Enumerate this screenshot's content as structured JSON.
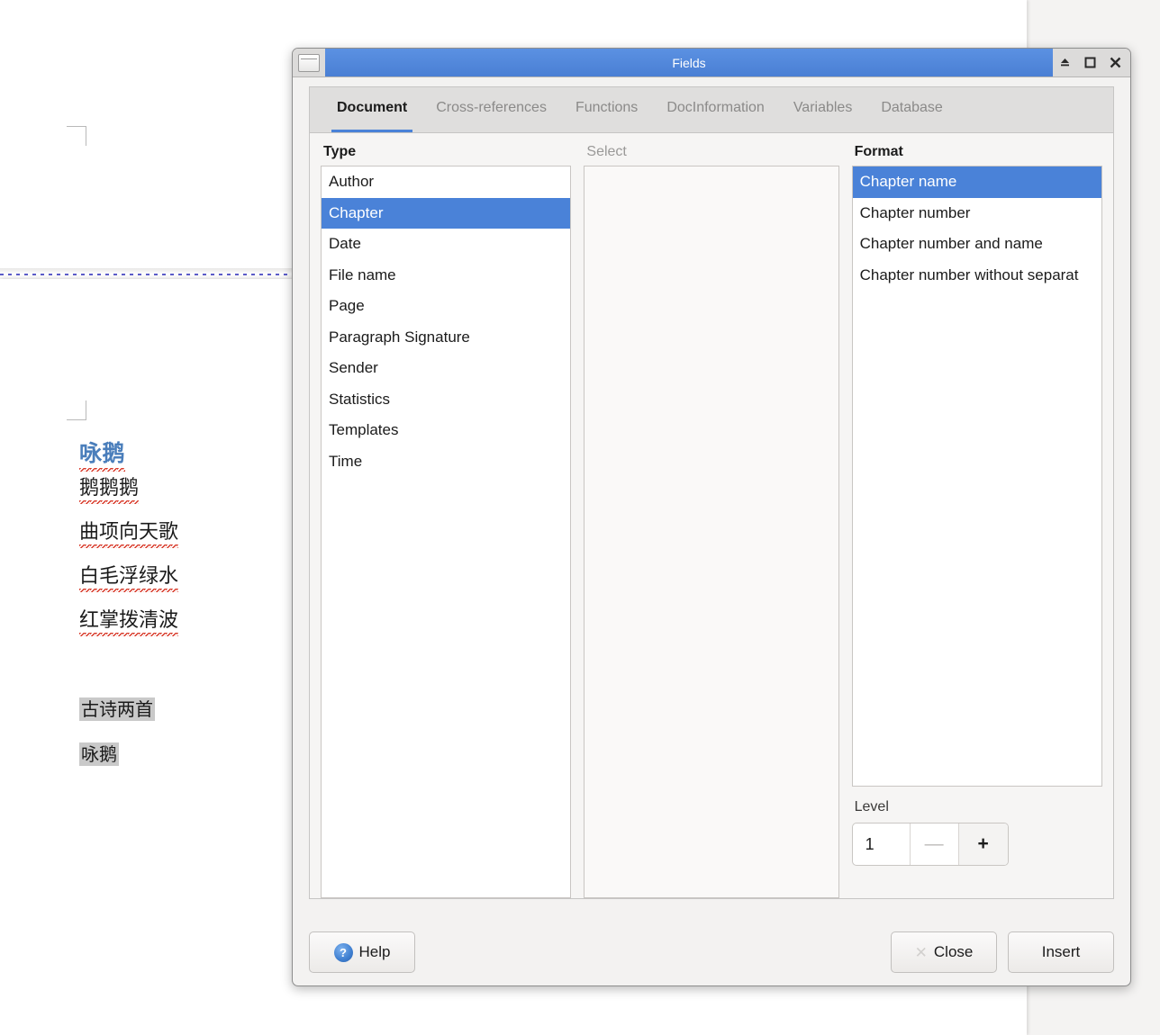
{
  "document": {
    "poem_title": "咏鹅",
    "poem_lines": [
      "鹅鹅鹅",
      "曲项向天歌",
      "白毛浮绿水",
      "红掌拨清波"
    ],
    "fields": [
      "古诗两首",
      "咏鹅"
    ],
    "heading_color": "#4a7ebb",
    "spellcheck_underline_color": "#d83a2a",
    "field_shading_color": "#c9c9c9",
    "page_break_line_color": "#5b5bc8"
  },
  "dialog": {
    "title": "Fields",
    "accent_color": "#4a82d8",
    "titlebar_color": "#4a7fd4",
    "window_buttons": [
      {
        "name": "minimize-icon",
        "glyph": "⏏"
      },
      {
        "name": "maximize-icon",
        "glyph": "❐"
      },
      {
        "name": "close-icon",
        "glyph": "✕"
      }
    ],
    "tabs": [
      {
        "label": "Document",
        "active": true
      },
      {
        "label": "Cross-references",
        "active": false
      },
      {
        "label": "Functions",
        "active": false
      },
      {
        "label": "DocInformation",
        "active": false
      },
      {
        "label": "Variables",
        "active": false
      },
      {
        "label": "Database",
        "active": false
      }
    ],
    "type": {
      "label": "Type",
      "items": [
        "Author",
        "Chapter",
        "Date",
        "File name",
        "Page",
        "Paragraph Signature",
        "Sender",
        "Statistics",
        "Templates",
        "Time"
      ],
      "selected": "Chapter"
    },
    "select": {
      "label": "Select",
      "items": [],
      "disabled": true
    },
    "format": {
      "label": "Format",
      "items": [
        "Chapter name",
        "Chapter number",
        "Chapter number and name",
        "Chapter number without separat"
      ],
      "selected": "Chapter name"
    },
    "level": {
      "label": "Level",
      "value": "1",
      "decrement_glyph": "—",
      "increment_glyph": "+"
    },
    "buttons": {
      "help": "Help",
      "close": "Close",
      "insert": "Insert"
    }
  }
}
